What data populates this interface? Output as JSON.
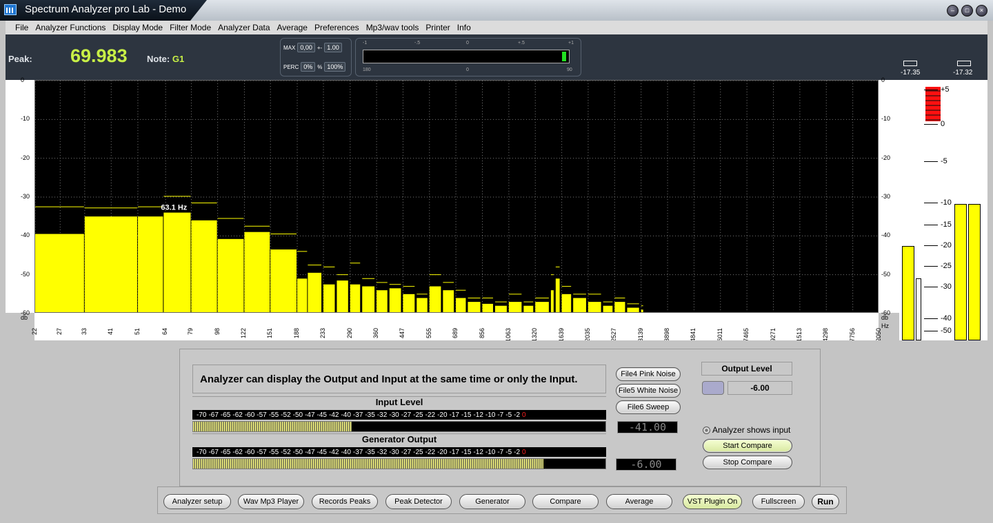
{
  "window": {
    "title": "Spectrum Analyzer pro Lab - Demo",
    "buttons": [
      "minimize",
      "maximize",
      "close"
    ]
  },
  "menu": [
    "File",
    "Analyzer Functions",
    "Display Mode",
    "Filter Mode",
    "Analyzer Data",
    "Average",
    "Preferences",
    "Mp3/wav tools",
    "Printer",
    "Info"
  ],
  "topbar": {
    "peak_label": "Peak:",
    "peak_value": "69.983",
    "note_label": "Note:",
    "note_value": "G1",
    "max_label": "MAX",
    "max_value": "0,00",
    "pm_label": "+-",
    "pm_value": "1.00",
    "perc_label": "PERC",
    "perc_value": "0%",
    "pct_sign": "%",
    "pct_value": "100%",
    "meter_top": [
      "-1",
      "-.5",
      "0",
      "+.5",
      "+1"
    ],
    "meter_bottom": [
      "180",
      "0",
      "90"
    ],
    "level_left": "-17.35",
    "level_right": "-17.32"
  },
  "chart_data": {
    "type": "bar",
    "ylabel": "db",
    "xlabel": "Hz",
    "ylim": [
      -60,
      0
    ],
    "y_ticks": [
      "0",
      "-10",
      "-20",
      "-30",
      "-40",
      "-50",
      "-60"
    ],
    "x_ticks": [
      "22",
      "27",
      "33",
      "41",
      "51",
      "64",
      "79",
      "98",
      "122",
      "151",
      "188",
      "233",
      "290",
      "360",
      "447",
      "555",
      "689",
      "856",
      "1063",
      "1320",
      "1639",
      "2035",
      "2527",
      "3139",
      "3898",
      "4841",
      "6011",
      "7465",
      "9271",
      "11513",
      "14298",
      "17756",
      "22050"
    ],
    "annotation": "63.1 Hz",
    "bars": [
      {
        "f": 22,
        "v": -39.5,
        "p": -32.5
      },
      {
        "f": 33,
        "v": -35,
        "p": -32.8
      },
      {
        "f": 51,
        "v": -35,
        "p": -32.5
      },
      {
        "f": 63,
        "v": -34,
        "p": -29.8
      },
      {
        "f": 79,
        "v": -36,
        "p": -31.5
      },
      {
        "f": 98,
        "v": -40.8,
        "p": -35.5
      },
      {
        "f": 122,
        "v": -39,
        "p": -37.5
      },
      {
        "f": 151,
        "v": -43.5,
        "p": -39.5
      },
      {
        "f": 188,
        "v": -51,
        "p": -44
      },
      {
        "f": 205,
        "v": -49.5,
        "p": -47.5
      },
      {
        "f": 233,
        "v": -52.5,
        "p": -48
      },
      {
        "f": 260,
        "v": -51.5,
        "p": -50
      },
      {
        "f": 290,
        "v": -52.5,
        "p": -47
      },
      {
        "f": 320,
        "v": -53,
        "p": -51
      },
      {
        "f": 360,
        "v": -54,
        "p": -52
      },
      {
        "f": 400,
        "v": -53.5,
        "p": -52.5
      },
      {
        "f": 447,
        "v": -55,
        "p": -53
      },
      {
        "f": 500,
        "v": -56,
        "p": -55
      },
      {
        "f": 555,
        "v": -53,
        "p": -50
      },
      {
        "f": 620,
        "v": -54,
        "p": -52
      },
      {
        "f": 689,
        "v": -56,
        "p": -54
      },
      {
        "f": 760,
        "v": -57,
        "p": -56
      },
      {
        "f": 856,
        "v": -57.5,
        "p": -56
      },
      {
        "f": 950,
        "v": -58,
        "p": -57
      },
      {
        "f": 1063,
        "v": -57,
        "p": -55
      },
      {
        "f": 1200,
        "v": -58,
        "p": -57
      },
      {
        "f": 1320,
        "v": -57,
        "p": -56
      },
      {
        "f": 1500,
        "v": -54,
        "p": -50
      },
      {
        "f": 1560,
        "v": -51,
        "p": -48
      },
      {
        "f": 1639,
        "v": -55,
        "p": -53
      },
      {
        "f": 1800,
        "v": -56,
        "p": -55
      },
      {
        "f": 2035,
        "v": -57,
        "p": -55
      },
      {
        "f": 2300,
        "v": -58,
        "p": -57
      },
      {
        "f": 2527,
        "v": -57,
        "p": -56
      },
      {
        "f": 2800,
        "v": -58.5,
        "p": -57.5
      },
      {
        "f": 3139,
        "v": -59,
        "p": -58
      }
    ],
    "vu_left_db": -22,
    "vu_right_db": -17.35,
    "vu_scale": [
      "+5",
      "0",
      "-5",
      "-10",
      "-15",
      "-20",
      "-25",
      "-30",
      "-40",
      "-50"
    ]
  },
  "panel": {
    "info": "Analyzer can display the Output and Input at the same time or only the Input.",
    "input_title": "Input Level",
    "output_title": "Generator Output",
    "scale": [
      "-70",
      "-67",
      "-65",
      "-62",
      "-60",
      "-57",
      "-55",
      "-52",
      "-50",
      "-47",
      "-45",
      "-42",
      "-40",
      "-37",
      "-35",
      "-32",
      "-30",
      "-27",
      "-25",
      "-22",
      "-20",
      "-17",
      "-15",
      "-12",
      "-10",
      "-7",
      "-5",
      "-2",
      "0"
    ],
    "input_level_db": -41,
    "output_level_db": -6,
    "input_lcd": "-41.00",
    "output_lcd": "-6.00",
    "file_buttons": [
      "File4 Pink Noise",
      "File5 White Noise",
      "File6 Sweep"
    ],
    "output_level_label": "Output Level",
    "output_level_value": "-6.00",
    "radio_label": "Analyzer shows  input",
    "start_compare": "Start Compare",
    "stop_compare": "Stop Compare"
  },
  "bottom_buttons": [
    "Analyzer setup",
    "Wav Mp3 Player",
    "Records Peaks",
    "Peak Detector",
    "Generator",
    "Compare",
    "Average",
    "VST Plugin On",
    "Fullscreen",
    "Run"
  ]
}
